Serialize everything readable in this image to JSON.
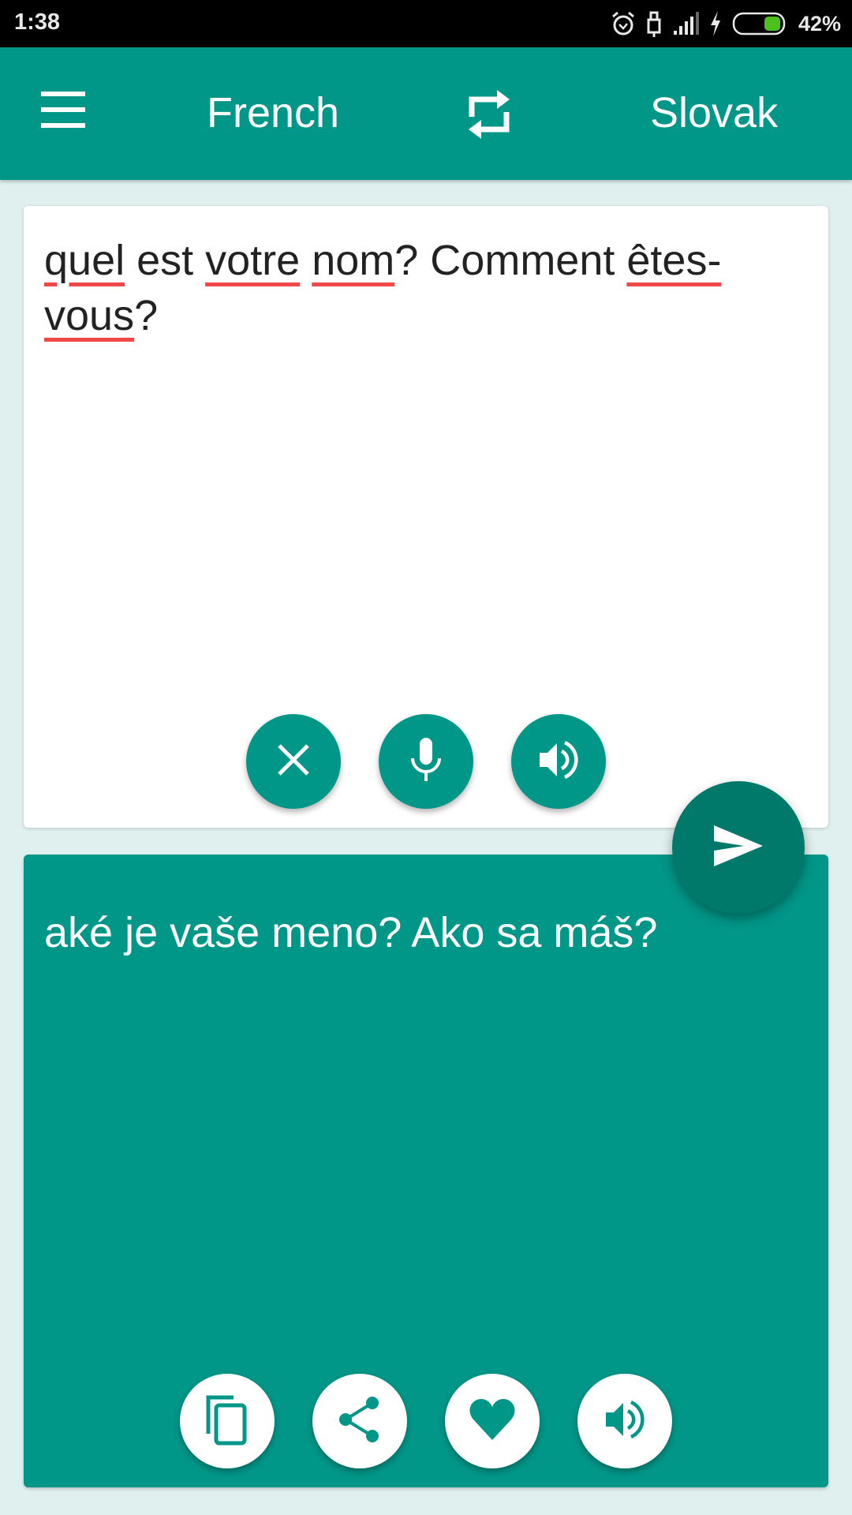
{
  "status_bar": {
    "time": "1:38",
    "battery_percent": "42%",
    "battery_level": 0.42,
    "icons": [
      "alarm-icon",
      "usb-icon",
      "signal-icon",
      "charging-icon",
      "battery-icon"
    ]
  },
  "app_bar": {
    "menu_icon": "hamburger-menu-icon",
    "source_language": "French",
    "swap_icon": "swap-languages-icon",
    "target_language": "Slovak"
  },
  "source": {
    "words": [
      {
        "text": "quel",
        "misspelled": true
      },
      {
        "text": " est ",
        "misspelled": false
      },
      {
        "text": "votre",
        "misspelled": true
      },
      {
        "text": " ",
        "misspelled": false
      },
      {
        "text": "nom",
        "misspelled": true
      },
      {
        "text": "? Comment ",
        "misspelled": false
      },
      {
        "text": "êtes-",
        "misspelled": true
      },
      {
        "text": "vous",
        "misspelled": true
      },
      {
        "text": "?",
        "misspelled": false
      }
    ],
    "buttons": [
      "clear-icon",
      "microphone-icon",
      "speaker-icon"
    ]
  },
  "send_button": {
    "icon": "send-icon"
  },
  "target": {
    "text": "aké je vaše meno? Ako sa máš?",
    "buttons": [
      "copy-icon",
      "share-icon",
      "favorite-icon",
      "speaker-icon"
    ]
  },
  "colors": {
    "primary": "#009688",
    "primary_dark": "#00796b",
    "background": "#dff0ee",
    "spellcheck_underline": "#f04848"
  }
}
